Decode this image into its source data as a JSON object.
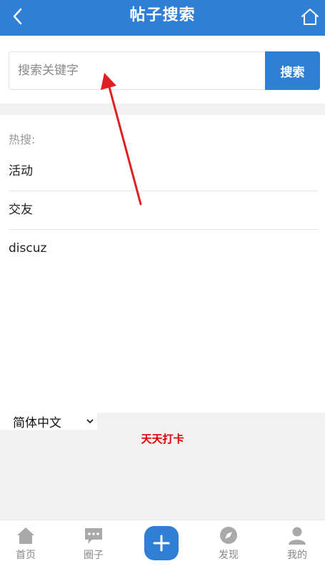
{
  "header": {
    "title": "帖子搜索",
    "back_icon": "chevron-left-icon",
    "home_icon": "home-icon",
    "color": "#2f7fd4"
  },
  "search": {
    "placeholder": "搜索关键字",
    "value": "",
    "button_label": "搜索"
  },
  "hot": {
    "label": "热搜:",
    "items": [
      "活动",
      "交友",
      "discuz"
    ]
  },
  "footer": {
    "language": "简体中文",
    "checkin_label": "天天打卡",
    "checkin_color": "#e00000"
  },
  "tabbar": {
    "items": [
      {
        "label": "首页",
        "icon": "house-icon"
      },
      {
        "label": "圈子",
        "icon": "chat-bubble-icon"
      },
      {
        "label": "",
        "icon": "plus-icon"
      },
      {
        "label": "发现",
        "icon": "compass-icon"
      },
      {
        "label": "我的",
        "icon": "user-icon"
      }
    ]
  },
  "annotation": {
    "color": "#e02020"
  }
}
